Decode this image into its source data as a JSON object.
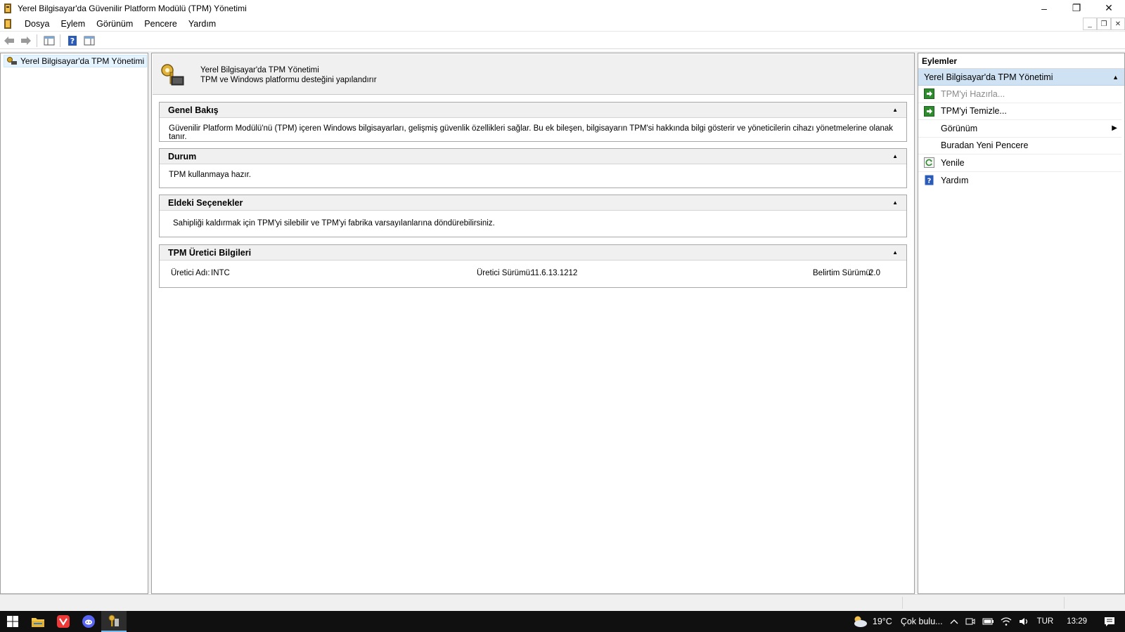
{
  "window": {
    "title": "Yerel Bilgisayar'da Güvenilir Platform Modülü (TPM) Yönetimi",
    "minimize": "–",
    "restore": "❐",
    "close": "✕"
  },
  "menu": {
    "items": [
      "Dosya",
      "Eylem",
      "Görünüm",
      "Pencere",
      "Yardım"
    ],
    "mdi_minimize": "_",
    "mdi_restore": "❐",
    "mdi_close": "✕"
  },
  "tree": {
    "root_label": "Yerel Bilgisayar'da TPM Yönetimi"
  },
  "content": {
    "header_title": "Yerel Bilgisayar'da TPM Yönetimi",
    "header_subtitle": "TPM ve Windows platformu desteğini yapılandırır",
    "sections": [
      {
        "title": "Genel Bakış",
        "body": "Güvenilir Platform Modülü'nü (TPM) içeren Windows bilgisayarları, gelişmiş güvenlik özellikleri sağlar. Bu ek bileşen, bilgisayarın TPM'si hakkında bilgi gösterir ve yöneticilerin cihazı yönetmelerine olanak tanır."
      },
      {
        "title": "Durum",
        "body": "TPM kullanmaya hazır."
      },
      {
        "title": "Eldeki Seçenekler",
        "body": "Sahipliği kaldırmak için TPM'yi silebilir ve TPM'yi fabrika varsayılanlarına döndürebilirsiniz."
      },
      {
        "title": "TPM Üretici Bilgileri",
        "manufacturer_name_label": "Üretici Adı:",
        "manufacturer_name_value": "INTC",
        "manufacturer_version_label": "Üretici Sürümü:",
        "manufacturer_version_value": "11.6.13.1212",
        "spec_version_label": "Belirtim Sürümü:",
        "spec_version_value": "2.0"
      }
    ],
    "collapse_glyph": "▲"
  },
  "actions": {
    "header": "Eylemler",
    "group_title": "Yerel Bilgisayar'da TPM Yönetimi",
    "group_arrow": "▲",
    "items": [
      {
        "label": "TPM'yi Hazırla...",
        "icon": "green-arrow-icon",
        "enabled": false
      },
      {
        "label": "TPM'yi Temizle...",
        "icon": "green-arrow-icon",
        "enabled": true
      },
      {
        "label": "Görünüm",
        "icon": "none",
        "enabled": true,
        "submenu": true
      },
      {
        "label": "Buradan Yeni Pencere",
        "icon": "none",
        "enabled": true
      },
      {
        "label": "Yenile",
        "icon": "refresh-icon",
        "enabled": true
      },
      {
        "label": "Yardım",
        "icon": "help-icon",
        "enabled": true
      }
    ],
    "submenu_glyph": "▶"
  },
  "taskbar": {
    "weather_temp": "19°C",
    "weather_text": "Çok bulu...",
    "language": "TUR",
    "time": "13:29"
  },
  "colors": {
    "accent_selection": "#cfe2f3",
    "taskbar": "#101010",
    "vivaldi": "#ef3939",
    "discord": "#5865f2"
  }
}
